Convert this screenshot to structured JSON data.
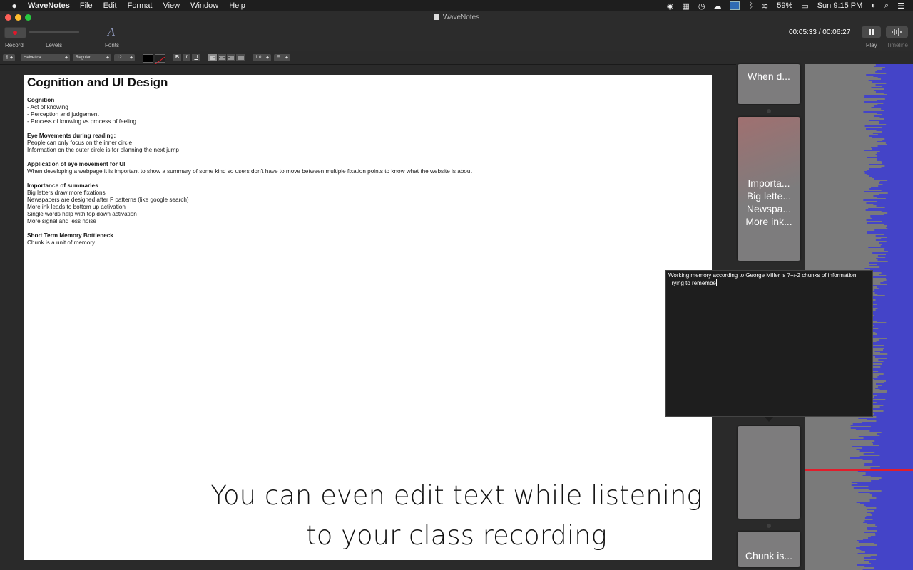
{
  "menu": {
    "app_name": "WaveNotes",
    "items": [
      "File",
      "Edit",
      "Format",
      "View",
      "Window",
      "Help"
    ],
    "battery": "59%",
    "clock": "Sun 9:15 PM"
  },
  "window": {
    "title": "WaveNotes"
  },
  "toolbar": {
    "record_label": "Record",
    "levels_label": "Levels",
    "fonts_label": "Fonts",
    "time_current": "00:05:33",
    "time_sep": "/",
    "time_total": "00:06:27",
    "play_label": "Play",
    "timeline_label": "Timeline"
  },
  "format_bar": {
    "paragraph": "¶",
    "font_family": "Helvetica",
    "font_style": "Regular",
    "font_size": "12",
    "bold": "B",
    "italic": "I",
    "underline": "U",
    "line_spacing": "1.0",
    "list": "☰",
    "text_color": "#000000"
  },
  "document": {
    "title": "Cognition and UI Design",
    "sections": [
      {
        "heading": "Cognition",
        "lines": [
          "- Act of knowing",
          "- Perception and judgement",
          "- Process of knowing vs process of feeling"
        ]
      },
      {
        "heading": "Eye Movements during reading:",
        "lines": [
          "People can only focus on the inner circle",
          "Information on the outer circle is for planning the next jump"
        ]
      },
      {
        "heading": "Application of eye movement for UI",
        "lines": [
          "When developing a webpage it is important to show a summary of some kind so users don't have to move between multiple fixation points to know what the website is about"
        ]
      },
      {
        "heading": "Importance of summaries",
        "lines": [
          "Big letters draw more fixations",
          "Newspapers are designed after F patterns (like google search)",
          "More ink leads to bottom up activation",
          "Single words help with top down activation",
          "More signal and less noise"
        ]
      },
      {
        "heading": "Short Term Memory Bottleneck",
        "lines": [
          "Chunk is a unit of memory"
        ]
      }
    ]
  },
  "caption": {
    "line1": "You can even edit text while listening",
    "line2": "to your class recording"
  },
  "cards": [
    {
      "lines": [
        "When d..."
      ]
    },
    {
      "lines": [
        "Importa...",
        "Big lette...",
        "Newspa...",
        "More ink..."
      ]
    },
    {
      "lines": []
    },
    {
      "lines": [
        "Chunk is..."
      ]
    }
  ],
  "popup": {
    "line1": "Working memory according to George Miller is 7+/-2 chunks of information",
    "line2": "Trying to remembe"
  },
  "colors": {
    "record_red": "#e0182b",
    "waveform_blue": "#4444c8",
    "playhead_red": "#e11d2b"
  }
}
